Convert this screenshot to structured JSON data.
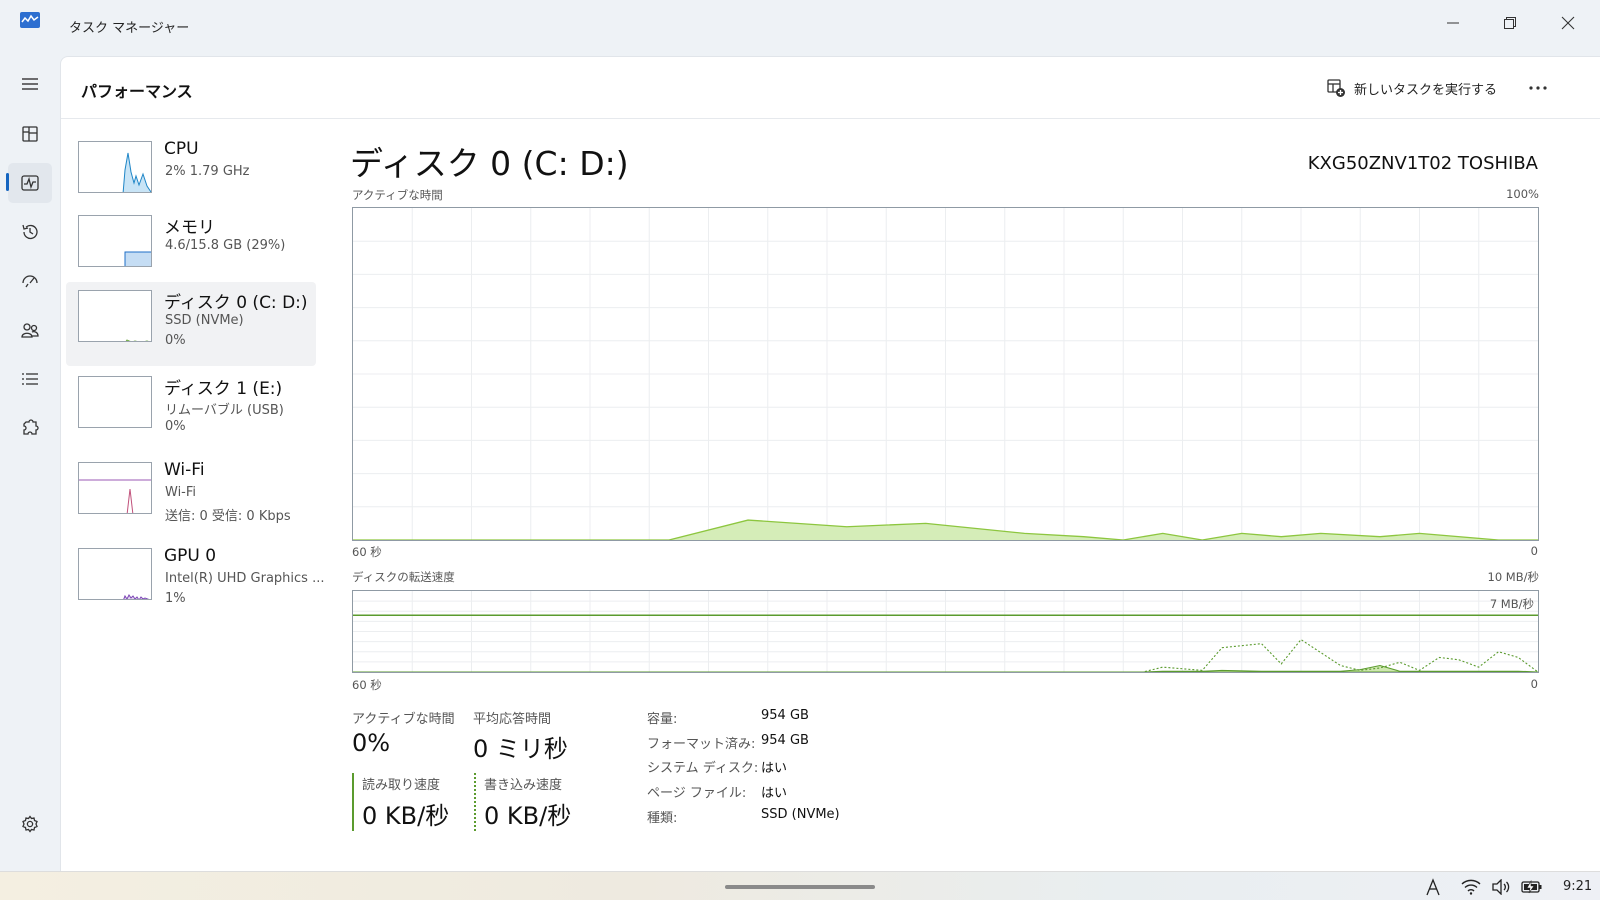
{
  "window": {
    "title": "タスク マネージャー"
  },
  "header": {
    "title": "パフォーマンス",
    "run_task_label": "新しいタスクを実行する"
  },
  "devices": [
    {
      "name": "CPU",
      "sub1": "2% 1.79 GHz",
      "sub2": ""
    },
    {
      "name": "メモリ",
      "sub1": "4.6/15.8 GB (29%)",
      "sub2": ""
    },
    {
      "name": "ディスク 0 (C: D:)",
      "sub1": "SSD (NVMe)",
      "sub2": "0%"
    },
    {
      "name": "ディスク 1 (E:)",
      "sub1": "リムーバブル (USB)",
      "sub2": "0%"
    },
    {
      "name": "Wi-Fi",
      "sub1": "Wi-Fi",
      "sub2": "送信: 0 受信: 0 Kbps"
    },
    {
      "name": "GPU 0",
      "sub1": "Intel(R) UHD Graphics ...",
      "sub2": "1%"
    }
  ],
  "detail": {
    "title": "ディスク 0 (C: D:)",
    "model": "KXG50ZNV1T02 TOSHIBA",
    "active_chart": {
      "label": "アクティブな時間",
      "max": "100%",
      "x_left": "60 秒",
      "x_right": "0"
    },
    "transfer_chart": {
      "label": "ディスクの転送速度",
      "max": "10 MB/秒",
      "line_label": "7 MB/秒",
      "x_left": "60 秒",
      "x_right": "0"
    }
  },
  "stats": {
    "active_time_label": "アクティブな時間",
    "active_time_value": "0%",
    "response_label": "平均応答時間",
    "response_value": "0 ミリ秒",
    "read_label": "読み取り速度",
    "read_value": "0 KB/秒",
    "write_label": "書き込み速度",
    "write_value": "0 KB/秒"
  },
  "properties": [
    {
      "label": "容量:",
      "value": "954 GB"
    },
    {
      "label": "フォーマット済み:",
      "value": "954 GB"
    },
    {
      "label": "システム ディスク:",
      "value": "はい"
    },
    {
      "label": "ページ ファイル:",
      "value": "はい"
    },
    {
      "label": "種類:",
      "value": "SSD (NVMe)"
    }
  ],
  "chart_data": [
    {
      "type": "area",
      "title": "アクティブな時間",
      "xlabel": "",
      "ylabel": "",
      "x": [
        60,
        44,
        40,
        35,
        31,
        26,
        23,
        21,
        19,
        17,
        15,
        13,
        11,
        8,
        6,
        2,
        0
      ],
      "series": [
        {
          "values": [
            0,
            0,
            6,
            4,
            5,
            2,
            1,
            0,
            2,
            0,
            2,
            1,
            2,
            1,
            2,
            0,
            0
          ]
        }
      ],
      "ylim": [
        0,
        100
      ],
      "xlim": [
        60,
        0
      ],
      "grid": true,
      "color": "#8dc63f"
    },
    {
      "type": "line",
      "title": "ディスクの転送速度",
      "xlabel": "",
      "ylabel": "",
      "x": [
        60,
        20,
        19,
        17,
        16,
        14,
        13,
        12,
        10,
        9,
        8,
        7,
        6,
        5,
        4,
        3,
        2,
        1,
        0
      ],
      "series": [
        {
          "values": [
            0,
            0,
            0.6,
            0.2,
            3,
            3.5,
            1,
            4,
            0.8,
            0.2,
            0.5,
            1.2,
            0.2,
            1.8,
            1.5,
            0.6,
            2.5,
            1.8,
            0
          ]
        },
        {
          "values": [
            0,
            0,
            0.1,
            0.1,
            0.2,
            0.1,
            0.1,
            0.1,
            0.1,
            0.3,
            0.8,
            0.1,
            0.1,
            0.1,
            0.1,
            0.1,
            0.1,
            0.1,
            0
          ]
        }
      ],
      "reference_line": 7,
      "ylim": [
        0,
        10
      ],
      "xlim": [
        60,
        0
      ],
      "grid": true,
      "color": "#5b9b2e"
    }
  ],
  "tray": {
    "time": "9:21"
  }
}
